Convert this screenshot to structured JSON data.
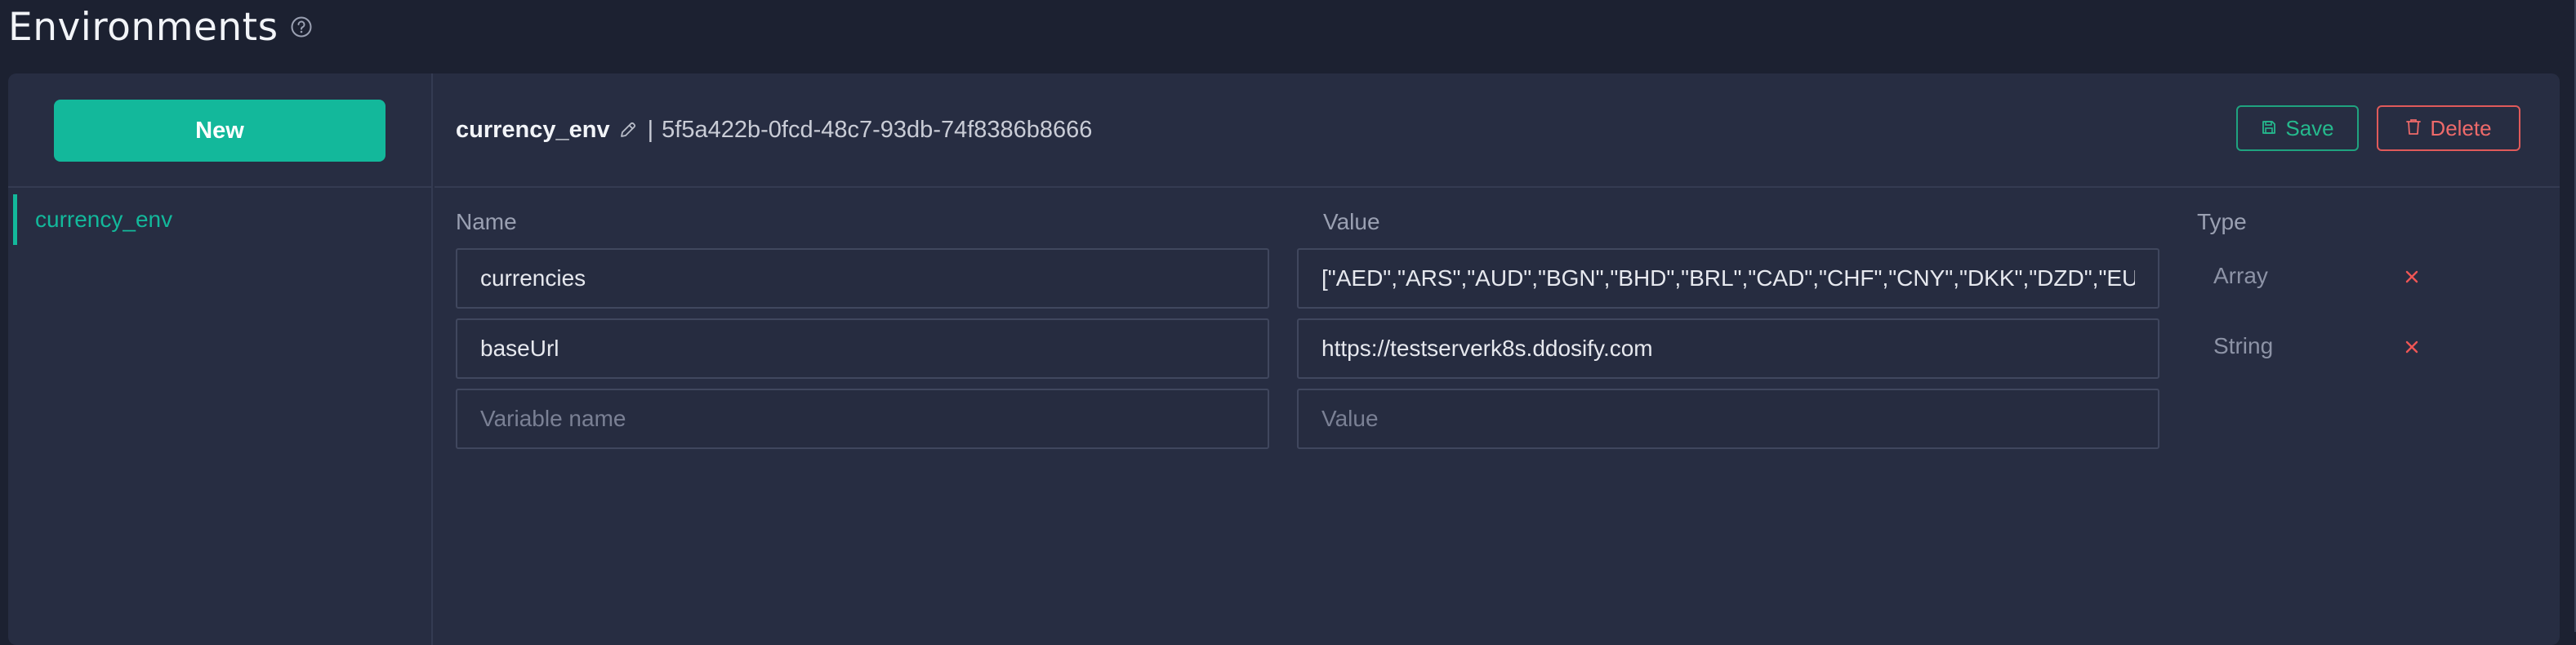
{
  "page": {
    "title": "Environments",
    "help_icon": "question-circle-icon"
  },
  "sidebar": {
    "new_button_label": "New",
    "items": [
      {
        "label": "currency_env",
        "selected": true
      }
    ]
  },
  "environment": {
    "name": "currency_env",
    "separator": "|",
    "id": "5f5a422b-0fcd-48c7-93db-74f8386b8666",
    "save_label": "Save",
    "delete_label": "Delete"
  },
  "columns": {
    "name": "Name",
    "value": "Value",
    "type": "Type"
  },
  "variables": [
    {
      "name": "currencies",
      "value": "[\"AED\",\"ARS\",\"AUD\",\"BGN\",\"BHD\",\"BRL\",\"CAD\",\"CHF\",\"CNY\",\"DKK\",\"DZD\",\"EUR\"]",
      "type": "Array"
    },
    {
      "name": "baseUrl",
      "value": "https://testserverk8s.ddosify.com",
      "type": "String"
    }
  ],
  "new_variable": {
    "name_placeholder": "Variable name",
    "value_placeholder": "Value"
  },
  "colors": {
    "accent": "#13b89b",
    "save": "#25b98d",
    "danger": "#ee6a6a",
    "panel_bg": "#272d42",
    "page_bg": "#1c2131"
  }
}
